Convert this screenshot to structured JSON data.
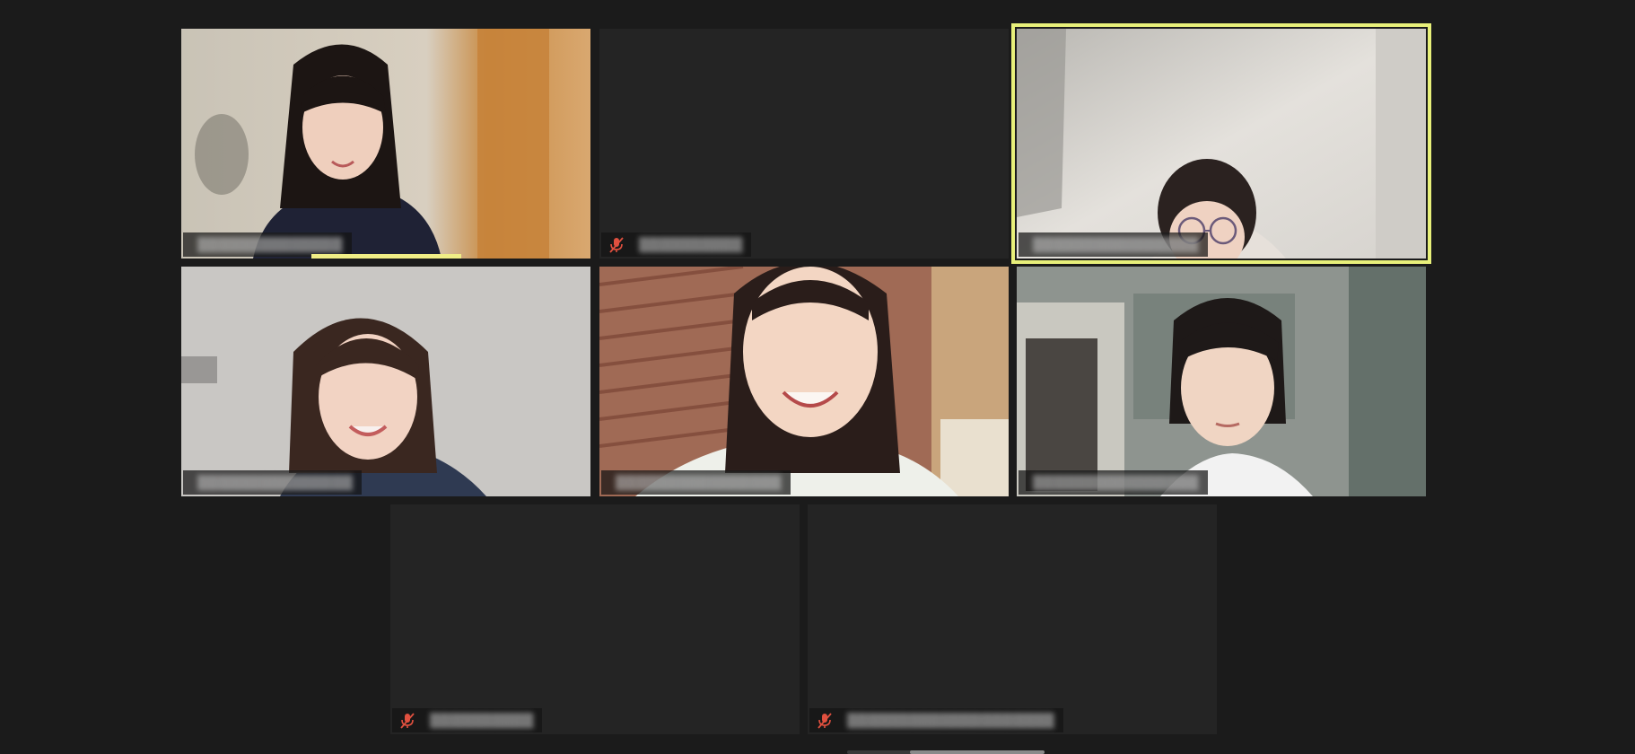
{
  "meeting": {
    "view": "gallery",
    "speaker_highlight_color": "#e8f07a",
    "tile_background": "#242424",
    "stage_background": "#1b1b1b"
  },
  "participants": [
    {
      "name": "",
      "muted": false,
      "video": true,
      "active": false
    },
    {
      "name": "",
      "muted": true,
      "video": false,
      "active": false
    },
    {
      "name": "",
      "muted": false,
      "video": true,
      "active": true
    },
    {
      "name": "",
      "muted": false,
      "video": true,
      "active": false
    },
    {
      "name": "",
      "muted": false,
      "video": true,
      "active": false
    },
    {
      "name": "",
      "muted": false,
      "video": true,
      "active": false
    },
    {
      "name": "",
      "muted": true,
      "video": false,
      "active": false
    },
    {
      "name": "",
      "muted": true,
      "video": false,
      "active": false
    }
  ],
  "icons": {
    "muted_mic": "mic-muted-icon"
  }
}
